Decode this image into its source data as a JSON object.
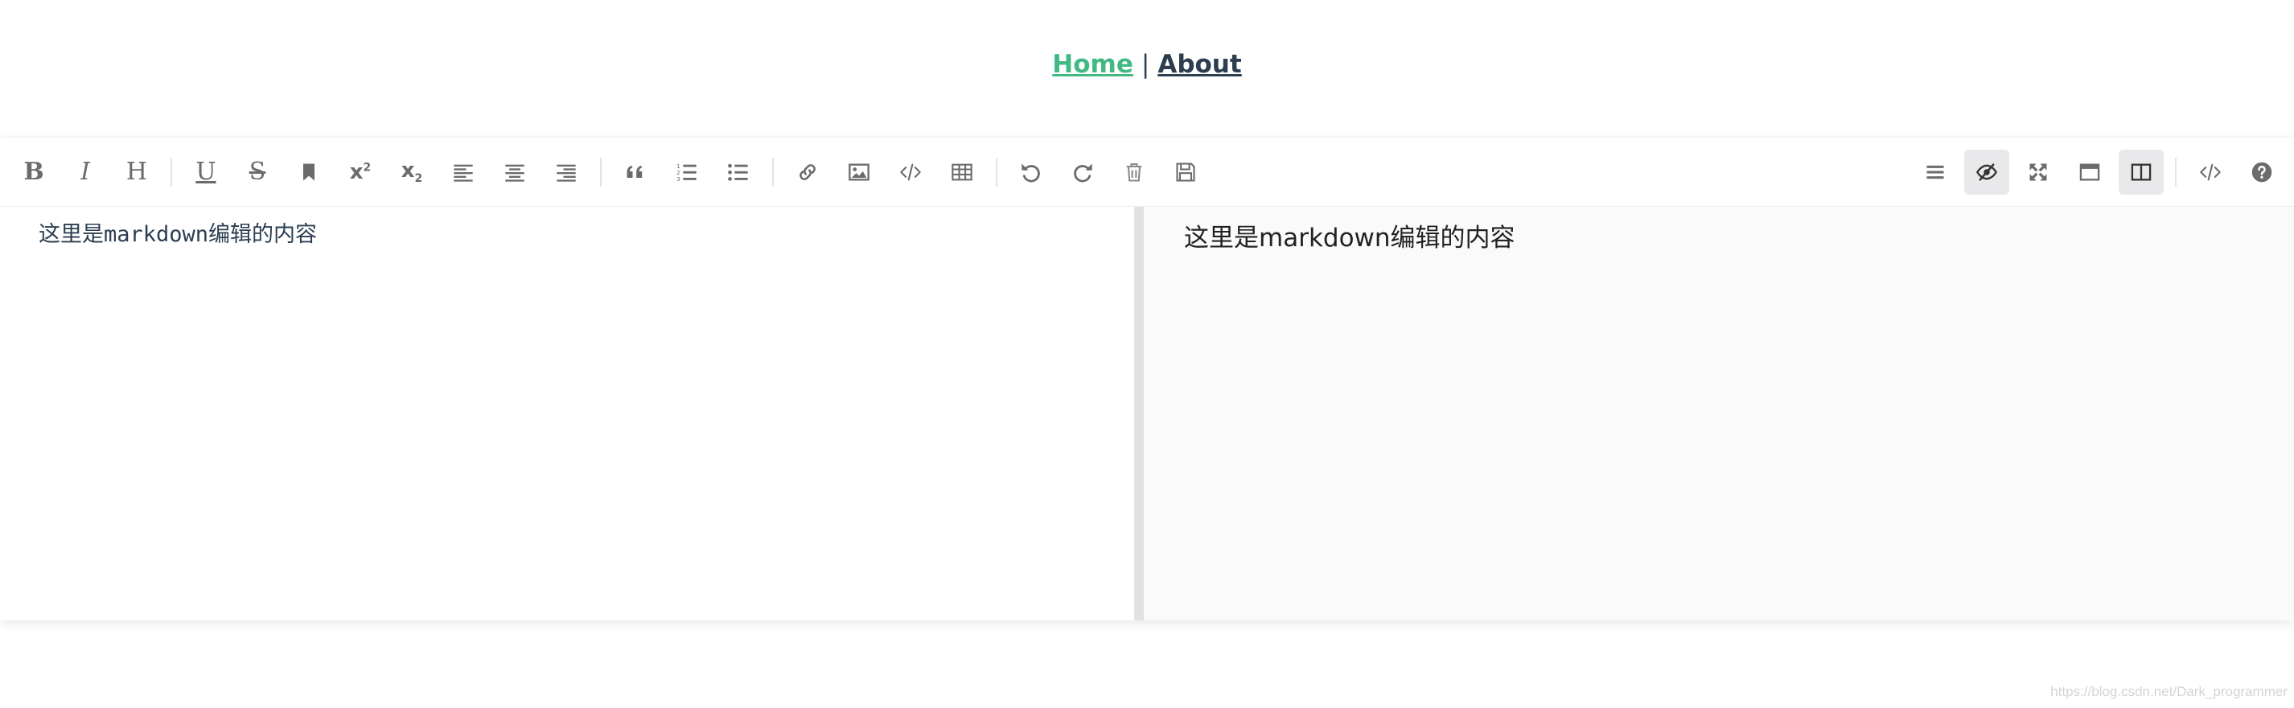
{
  "nav": {
    "home": "Home",
    "separator": "|",
    "about": "About",
    "active_color": "#42b983"
  },
  "toolbar": {
    "left_groups": [
      [
        "bold-icon",
        "italic-icon",
        "header-icon"
      ],
      [
        "underline-icon",
        "strikethrough-icon",
        "bookmark-icon",
        "superscript-icon",
        "subscript-icon",
        "align-left-icon",
        "align-center-icon",
        "align-right-icon"
      ],
      [
        "quote-icon",
        "ordered-list-icon",
        "unordered-list-icon"
      ],
      [
        "link-icon",
        "image-icon",
        "code-icon",
        "table-icon"
      ],
      [
        "undo-icon",
        "redo-icon",
        "trash-icon",
        "save-icon"
      ]
    ],
    "right_groups": [
      [
        "navigation-icon",
        "preview-toggle-icon",
        "fullscreen-icon",
        "read-mode-icon",
        "subfield-icon"
      ],
      [
        "html-code-icon",
        "help-icon"
      ]
    ],
    "selected_buttons": [
      "preview-toggle-icon",
      "subfield-icon"
    ],
    "labels": {
      "bold": "B",
      "italic": "I",
      "header": "H",
      "underline": "U",
      "strike": "S",
      "sup_base": "x",
      "sup_index": "2",
      "sub_base": "x",
      "sub_index": "2"
    }
  },
  "editor": {
    "source_text": "这里是markdown编辑的内容",
    "preview_text": "这里是markdown编辑的内容"
  },
  "watermark": "https://blog.csdn.net/Dark_programmer"
}
